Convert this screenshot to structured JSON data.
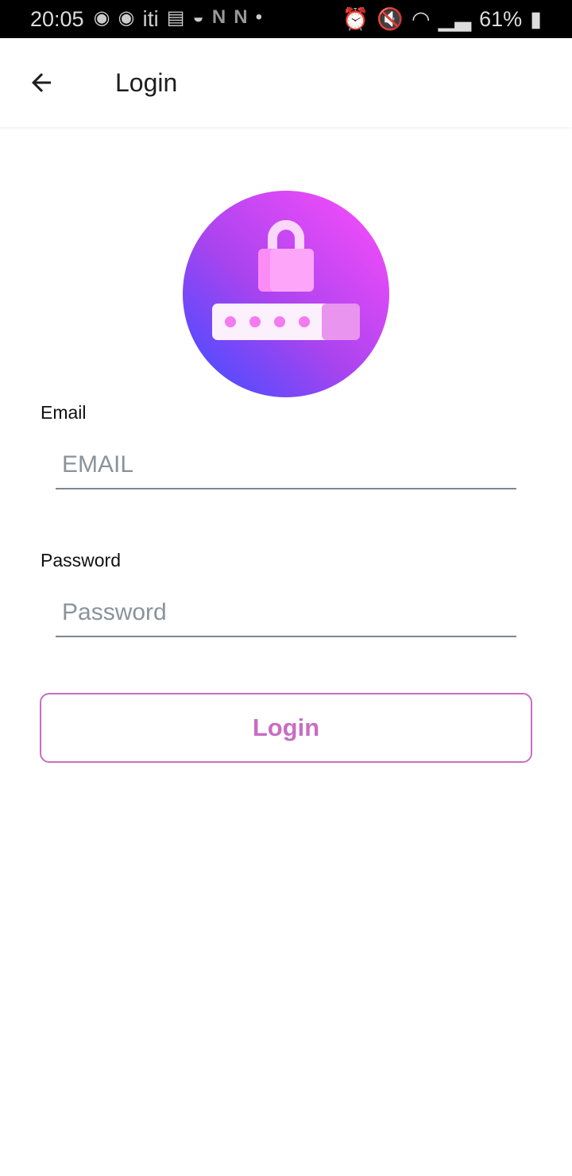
{
  "status_bar": {
    "time": "20:05",
    "notification_icons": [
      "headphone-face-icon",
      "headphone-face-icon",
      "iti-icon",
      "holy-bible-icon",
      "smile-icon",
      "netflix-icon",
      "netflix-icon",
      "dot-icon"
    ],
    "iti_text": "iti",
    "battery": "61%",
    "system_icons": [
      "alarm-icon",
      "mute-icon",
      "wifi-icon",
      "signal-icon",
      "battery-charging-icon"
    ]
  },
  "appbar": {
    "title": "Login",
    "back_icon": "arrow-left-icon"
  },
  "logo": {
    "icon": "lock-password-icon",
    "colors": {
      "top": "#f04cf9",
      "bottom": "#4a4cff"
    }
  },
  "form": {
    "email_label": "Email",
    "email_placeholder": "EMAIL",
    "email_value": "",
    "password_label": "Password",
    "password_placeholder": "Password",
    "password_value": "",
    "login_label": "Login"
  },
  "colors": {
    "accent": "#c86dc4"
  }
}
